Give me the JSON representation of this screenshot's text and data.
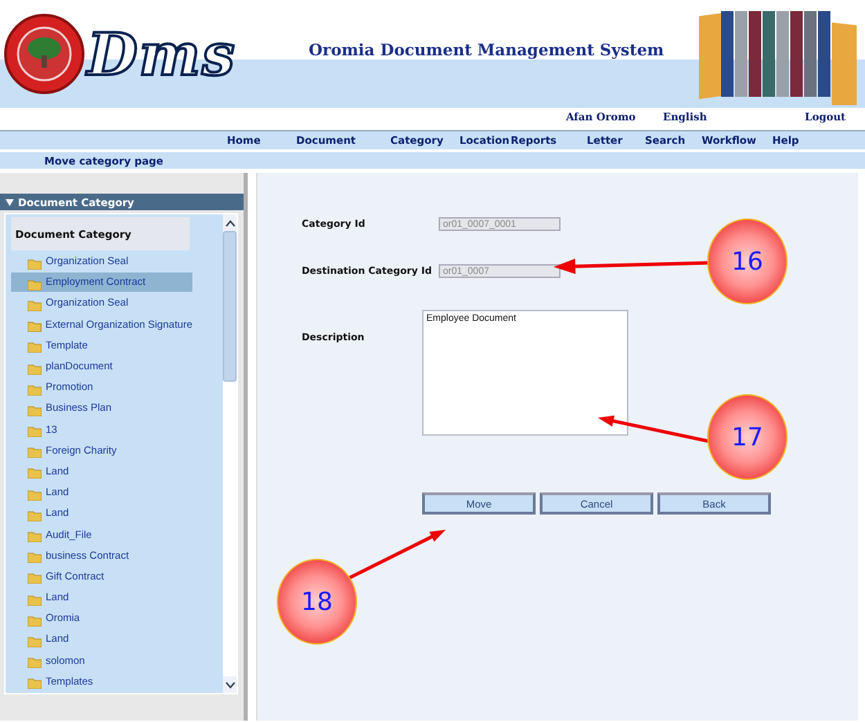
{
  "header": {
    "logo_text": "Dms",
    "title": "Oromia Document Management System"
  },
  "language_links": [
    {
      "label": "Afan Oromo"
    },
    {
      "label": "English"
    }
  ],
  "logout": "Logout",
  "nav": [
    "Home",
    "Document",
    "Category",
    "Location",
    "Reports",
    "Letter",
    "Search",
    "Workflow",
    "Help"
  ],
  "breadcrumb": "Move category page",
  "sidebar": {
    "panel_title": "Document Category",
    "tree_title": "Document Category",
    "items": [
      {
        "label": "Organization Seal",
        "selected": false
      },
      {
        "label": "Employment Contract",
        "selected": true
      },
      {
        "label": "Organization Seal",
        "selected": false
      },
      {
        "label": "External Organization Signature",
        "selected": false
      },
      {
        "label": "Template",
        "selected": false
      },
      {
        "label": "planDocument",
        "selected": false
      },
      {
        "label": "Promotion",
        "selected": false
      },
      {
        "label": "Business Plan",
        "selected": false
      },
      {
        "label": "13",
        "selected": false
      },
      {
        "label": "Foreign Charity",
        "selected": false
      },
      {
        "label": "Land",
        "selected": false
      },
      {
        "label": "Land",
        "selected": false
      },
      {
        "label": "Land",
        "selected": false
      },
      {
        "label": "Audit_File",
        "selected": false
      },
      {
        "label": "business Contract",
        "selected": false
      },
      {
        "label": "Gift Contract",
        "selected": false
      },
      {
        "label": "Land",
        "selected": false
      },
      {
        "label": "Oromia",
        "selected": false
      },
      {
        "label": "Land",
        "selected": false
      },
      {
        "label": "solomon",
        "selected": false
      },
      {
        "label": "Templates",
        "selected": false
      }
    ]
  },
  "form": {
    "fields": [
      {
        "label": "Category Id",
        "value": "or01_0007_0001",
        "disabled": true
      },
      {
        "label": "Destination Category Id",
        "value": "or01_0007",
        "disabled": true
      }
    ],
    "description": {
      "label": "Description",
      "value": "Employee Document"
    },
    "buttons": [
      "Move",
      "Cancel",
      "Back"
    ]
  },
  "callouts": [
    {
      "number": "16"
    },
    {
      "number": "17"
    },
    {
      "number": "18"
    }
  ]
}
